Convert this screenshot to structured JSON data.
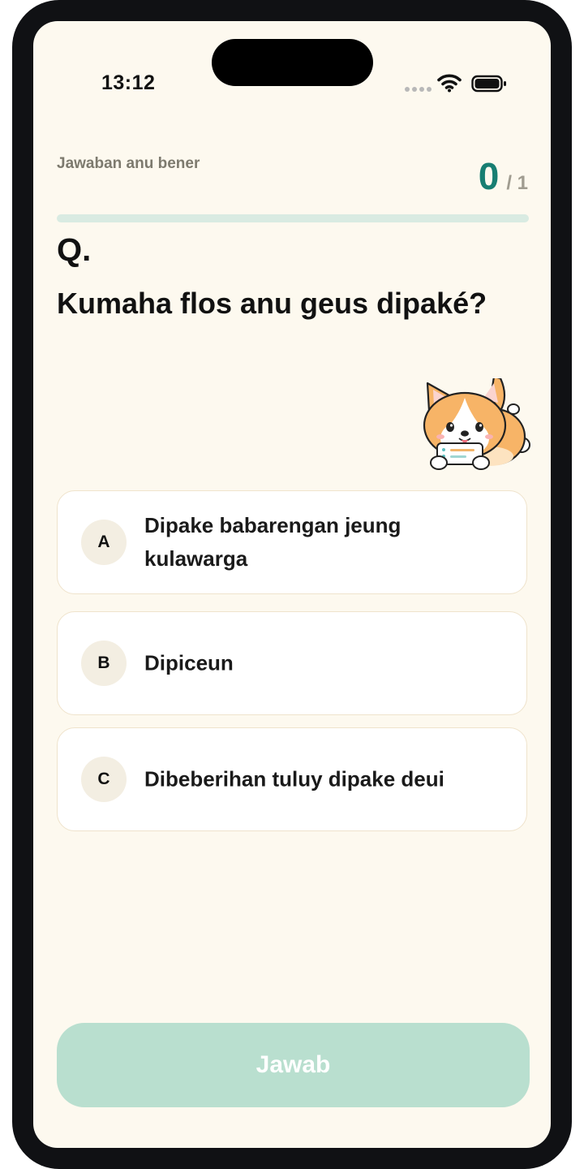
{
  "status_bar": {
    "time": "13:12"
  },
  "quiz": {
    "score_label": "Jawaban anu bener",
    "score_current": "0",
    "score_total": "/ 1",
    "progress_fraction": 0,
    "question_marker": "Q.",
    "question": "Kumaha flos anu geus dipaké?",
    "options": [
      {
        "letter": "A",
        "text": "Dipake babarengan jeung kulawarga"
      },
      {
        "letter": "B",
        "text": "Dipiceun"
      },
      {
        "letter": "C",
        "text": "Dibeberihan tuluy dipake deui"
      }
    ],
    "answer_button": "Jawab"
  },
  "colors": {
    "accent": "#177e72",
    "background": "#fdf9ef",
    "button_disabled": "#b9dfcf",
    "progress_track": "#d9ebe2"
  },
  "icons": {
    "status": [
      "cellular-signal-icon",
      "wifi-icon",
      "battery-icon"
    ],
    "mascot": "corgi-mascot-illustration"
  }
}
